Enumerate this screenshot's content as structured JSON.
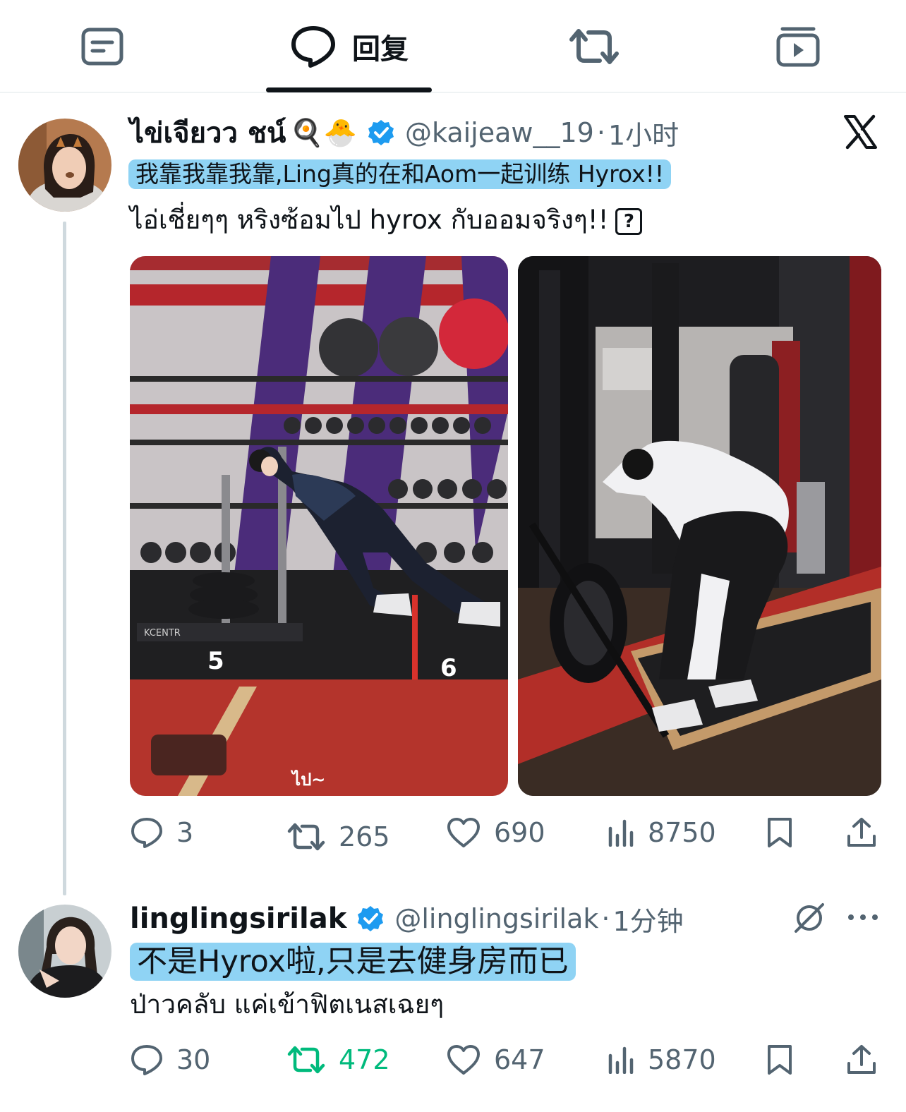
{
  "tabs": [
    {
      "name": "notes",
      "icon": "note-icon",
      "label": ""
    },
    {
      "name": "reply",
      "icon": "reply-bubble-icon",
      "label": "回复",
      "active": true
    },
    {
      "name": "retweet",
      "icon": "retweet-icon",
      "label": ""
    },
    {
      "name": "video",
      "icon": "video-icon",
      "label": ""
    }
  ],
  "tweet1": {
    "display_name": "ไข่เจียวว ชน์",
    "emoji": "🍳🐣",
    "handle": "@kaijeaw__19",
    "separator": "·",
    "time": "1小时",
    "translation": "我靠我靠我靠,Ling真的在和Aom一起训练 Hyrox!!",
    "text": "ไอ่เชี่ยๆๆ หริงซ้อมไป hyrox กับออมจริงๆ!!",
    "unknown_glyph": "?",
    "image_caption": "ไป~",
    "stats": {
      "replies": "3",
      "retweets": "265",
      "likes": "690",
      "views": "8750"
    }
  },
  "tweet2": {
    "display_name": "linglingsirilak",
    "handle": "@linglingsirilak",
    "separator": "·",
    "time": "1分钟",
    "translation": "不是Hyrox啦,只是去健身房而已",
    "text": "ป่าวคลับ แค่เข้าฟิตเนสเฉยๆ",
    "stats": {
      "replies": "30",
      "retweets": "472",
      "likes": "647",
      "views": "5870"
    }
  },
  "colors": {
    "text": "#0f1419",
    "muted": "#536471",
    "highlight": "#8fd3f4",
    "verified": "#1d9bf0",
    "retweet_active": "#00ba7c"
  }
}
